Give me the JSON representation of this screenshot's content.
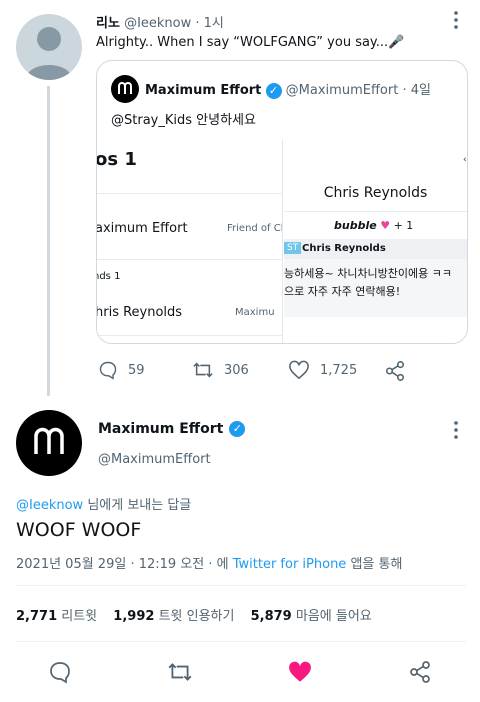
{
  "reply": {
    "name": "리노",
    "handle": "@Ieeknow",
    "time": "· 1시",
    "text": "Alrighty.. When I say “WOLFGANG” you say...🎤",
    "quote": {
      "name": "Maximum Effort",
      "handle": "@MaximumEffort",
      "time": "· 4일",
      "text": "@Stray_Kids 안녕하세요",
      "left_media": {
        "section1": "os 1",
        "row1_name": "aximum Effort",
        "row1_meta": "Friend of Ch",
        "section2": "nds 1",
        "row2_name": "hris Reynolds",
        "row2_meta": "Maximu"
      },
      "right_media": {
        "title": "Chris Reynolds",
        "bubble": "bubble",
        "plus": "+ 1",
        "badge": "ST",
        "sender": "Chris Reynolds",
        "msg1": "능하세용~ 차니차니방찬이에용 ㅋㅋ",
        "msg2": "으로 자주 자주 연락해용!"
      }
    },
    "actions": {
      "replies": "59",
      "retweets": "306",
      "likes": "1,725"
    }
  },
  "main": {
    "name": "Maximum Effort",
    "handle": "@MaximumEffort",
    "reply_to_handle": "@Ieeknow",
    "reply_to_suffix": " 님에게 보내는 답글",
    "text": "WOOF WOOF",
    "date": "2021년 05월 29일 · 12:19 오전 · 에 ",
    "source": "Twitter for iPhone",
    "source_suffix": " 앱을 통해",
    "stats": {
      "retweets": "2,771",
      "retweets_label": "리트윗",
      "quotes": "1,992",
      "quotes_label": "트윗 인용하기",
      "likes": "5,879",
      "likes_label": "마음에 들어요"
    }
  },
  "colors": {
    "accent": "#1d9bf0",
    "like": "#f91880",
    "text": "#0f1419",
    "muted": "#536471"
  }
}
